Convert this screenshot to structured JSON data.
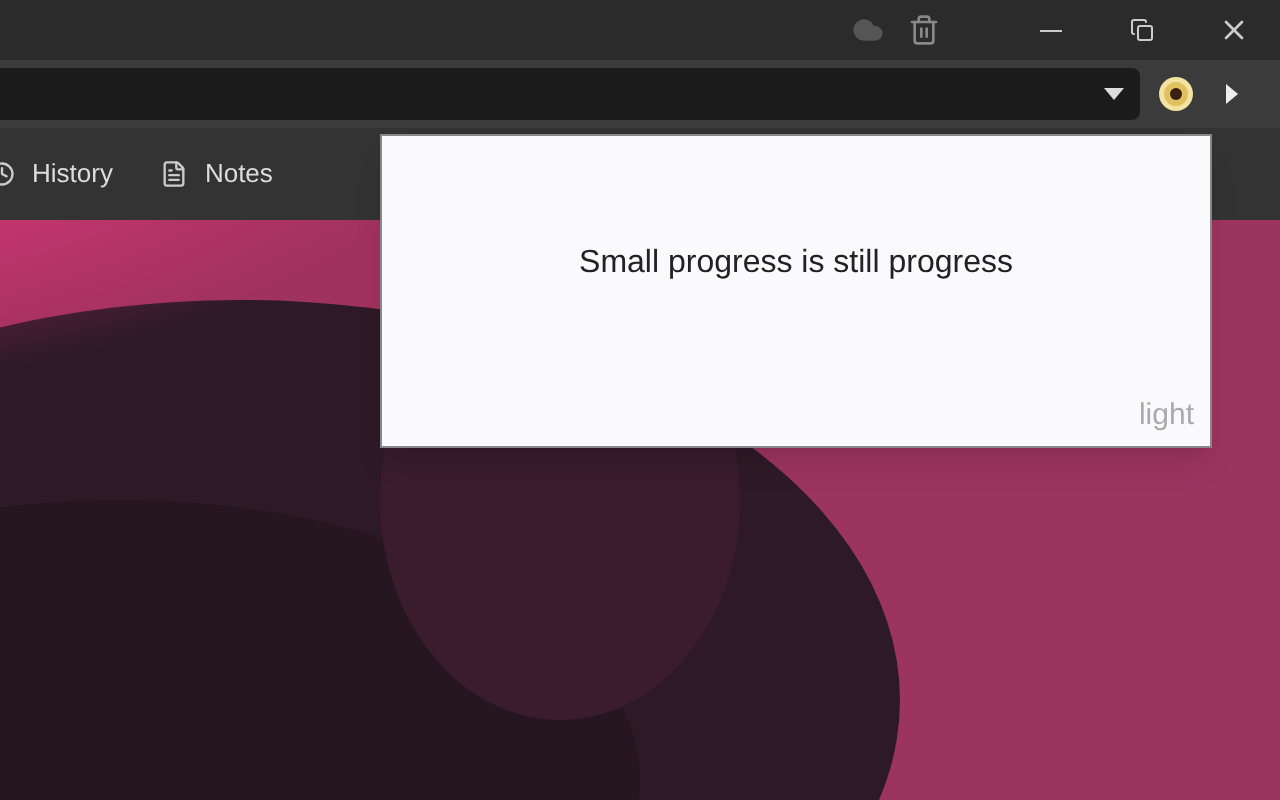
{
  "bookmarks": [
    {
      "label": "History",
      "kind": "history"
    },
    {
      "label": "Notes",
      "kind": "notes"
    }
  ],
  "popup": {
    "quote": "Small progress is still progress",
    "theme": "light"
  }
}
